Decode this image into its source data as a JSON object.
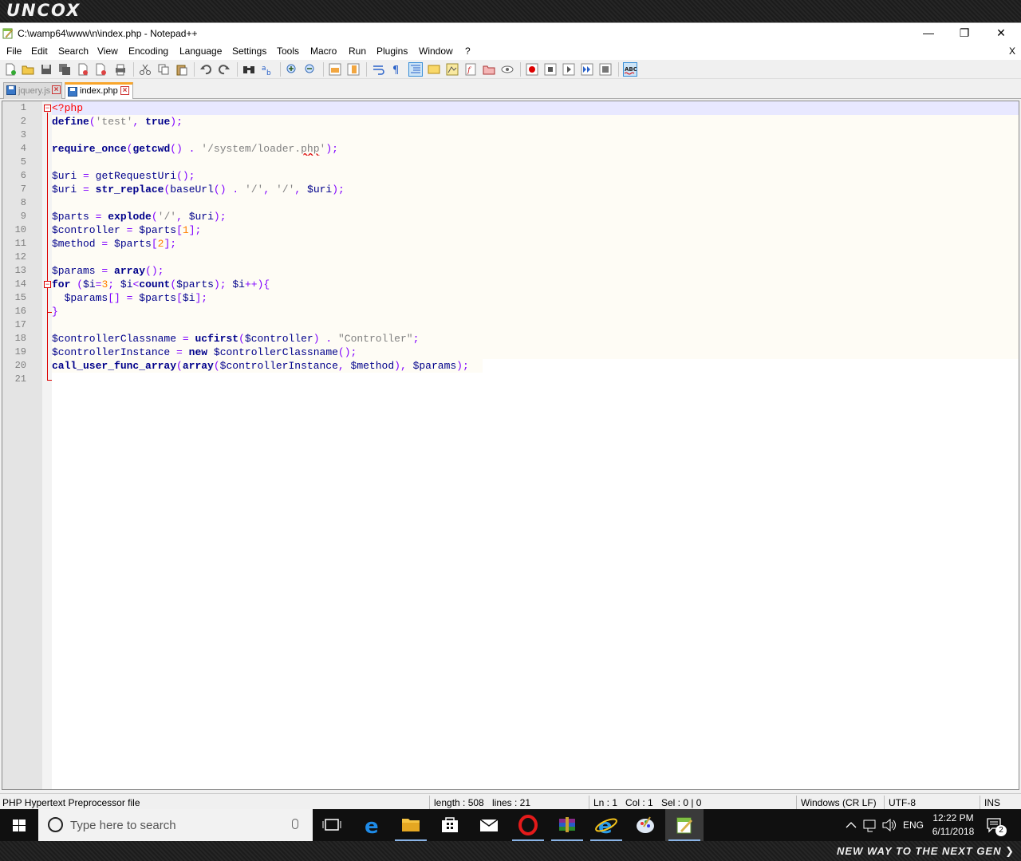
{
  "watermark": {
    "brand": "UNCOX",
    "slogan": "NEW WAY TO THE NEXT GEN ❯"
  },
  "window": {
    "title": "C:\\wamp64\\www\\n\\index.php - Notepad++",
    "minimize": "—",
    "maximize": "❐",
    "close": "✕"
  },
  "menu": [
    "File",
    "Edit",
    "Search",
    "View",
    "Encoding",
    "Language",
    "Settings",
    "Tools",
    "Macro",
    "Run",
    "Plugins",
    "Window",
    "?"
  ],
  "menu_close_doc": "X",
  "tabs": [
    {
      "label": "jquery.js",
      "active": false
    },
    {
      "label": "index.php",
      "active": true
    }
  ],
  "code": {
    "line_numbers": [
      "1",
      "2",
      "3",
      "4",
      "5",
      "6",
      "7",
      "8",
      "9",
      "10",
      "11",
      "12",
      "13",
      "14",
      "15",
      "16",
      "17",
      "18",
      "19",
      "20",
      "21"
    ],
    "lines": [
      "<?php",
      "define('test', true);",
      "",
      "require_once(getcwd() . '/system/loader.php');",
      "",
      "$uri = getRequestUri();",
      "$uri = str_replace(baseUrl() . '/', '/', $uri);",
      "",
      "$parts = explode('/', $uri);",
      "$controller = $parts[1];",
      "$method = $parts[2];",
      "",
      "$params = array();",
      "for ($i=3; $i<count($parts); $i++){",
      "  $params[] = $parts[$i];",
      "}",
      "",
      "$controllerClassname = ucfirst($controller) . \"Controller\";",
      "$controllerInstance = new $controllerClassname();",
      "call_user_func_array(array($controllerInstance, $method), $params);",
      ""
    ]
  },
  "status": {
    "filetype": "PHP Hypertext Preprocessor file",
    "length": "length : 508",
    "lines": "lines : 21",
    "ln": "Ln : 1",
    "col": "Col : 1",
    "sel": "Sel : 0 | 0",
    "eol": "Windows (CR LF)",
    "encoding": "UTF-8",
    "mode": "INS"
  },
  "taskbar": {
    "search_placeholder": "Type here to search",
    "time": "12:22 PM",
    "date": "6/11/2018",
    "lang": "ENG",
    "notifications": "2"
  }
}
